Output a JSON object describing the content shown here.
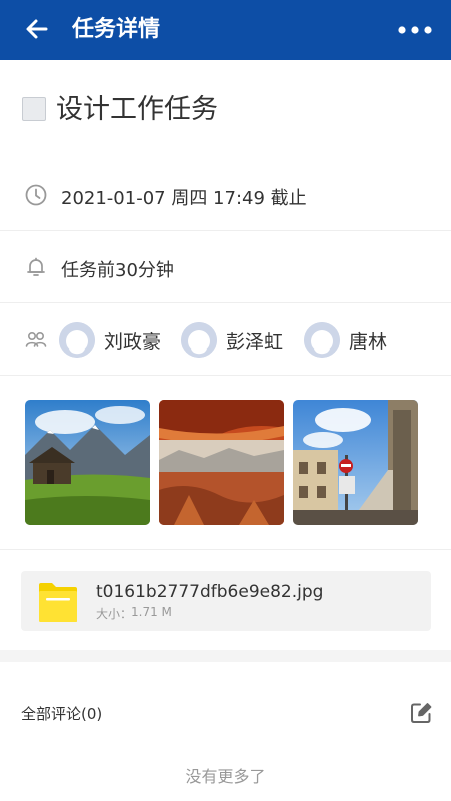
{
  "header": {
    "title": "任务详情",
    "back_icon": "back-arrow-icon",
    "more_icon": "more-dots-icon",
    "background": "#0d4ea6"
  },
  "task": {
    "title": "设计工作任务",
    "completed": false
  },
  "deadline": {
    "icon": "clock-icon",
    "text": "2021-01-07 周四 17:49 截止"
  },
  "reminder": {
    "icon": "bell-icon",
    "text": "任务前30分钟"
  },
  "members": {
    "icon": "people-icon",
    "list": [
      {
        "name": "刘政豪",
        "avatar_icon": "avatar-placeholder-icon"
      },
      {
        "name": "彭泽虹",
        "avatar_icon": "avatar-placeholder-icon"
      },
      {
        "name": "唐林",
        "avatar_icon": "avatar-placeholder-icon"
      }
    ]
  },
  "photos": [
    {
      "subject": "mountain-cabin-landscape"
    },
    {
      "subject": "canyon-arch-landscape"
    },
    {
      "subject": "street-building-scene"
    }
  ],
  "attachment": {
    "icon": "folder-icon",
    "file_name": "t0161b2777dfb6e9e82.jpg",
    "size_label": "大小：",
    "size_value": "1.71 M"
  },
  "comments": {
    "label": "全部评论(0)",
    "edit_icon": "edit-icon"
  },
  "footer": {
    "no_more": "没有更多了"
  }
}
